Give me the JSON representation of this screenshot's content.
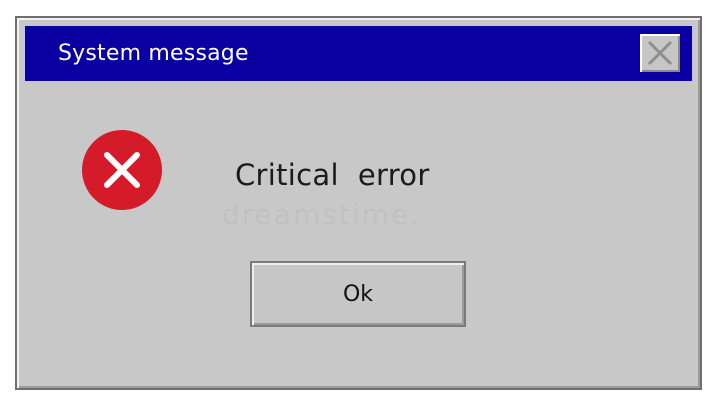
{
  "dialog": {
    "title": "System message",
    "message": "Critical  error",
    "watermark": "dreamstime.",
    "ok_label": "Ok"
  },
  "icons": {
    "close": "close-icon",
    "error": "error-icon"
  },
  "colors": {
    "titlebar": "#0a00a2",
    "dialog_bg": "#c8c8c8",
    "error_red": "#d51a2a"
  }
}
